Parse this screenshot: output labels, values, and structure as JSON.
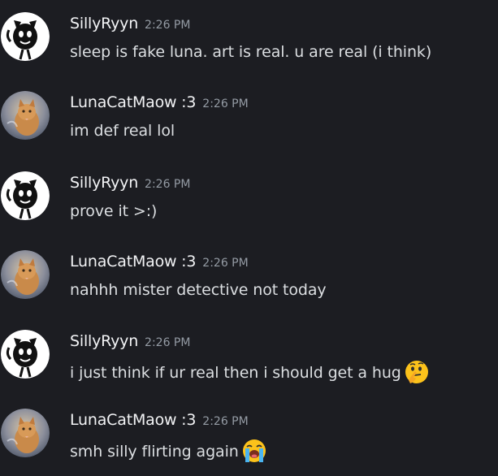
{
  "messages": [
    {
      "author": "SillyRyyn",
      "time": "2:26 PM",
      "text": "sleep is fake luna. art is real. u are real (i think)",
      "avatar": "stick-cat-avatar-icon",
      "emoji": ""
    },
    {
      "author": "LunaCatMaow :3",
      "time": "2:26 PM",
      "text": "im def real lol",
      "avatar": "cat-photo-avatar-icon",
      "emoji": ""
    },
    {
      "author": "SillyRyyn",
      "time": "2:26 PM",
      "text": "prove it >:)",
      "avatar": "stick-cat-avatar-icon",
      "emoji": ""
    },
    {
      "author": "LunaCatMaow :3",
      "time": "2:26 PM",
      "text": "nahhh mister detective not today",
      "avatar": "cat-photo-avatar-icon",
      "emoji": ""
    },
    {
      "author": "SillyRyyn",
      "time": "2:26 PM",
      "text": "i just think if ur real then i should get a hug",
      "avatar": "stick-cat-avatar-icon",
      "emoji": "thinking-face-emoji-icon"
    },
    {
      "author": "LunaCatMaow :3",
      "time": "2:26 PM",
      "text": "smh silly flirting again",
      "avatar": "cat-photo-avatar-icon",
      "emoji": "loudly-crying-face-emoji-icon"
    }
  ],
  "colors": {
    "background": "#1c1d22",
    "author": "#f2f3f5",
    "text": "#dbdee1",
    "timestamp": "#949ba4",
    "emoji_yellow": "#fcc21b"
  }
}
